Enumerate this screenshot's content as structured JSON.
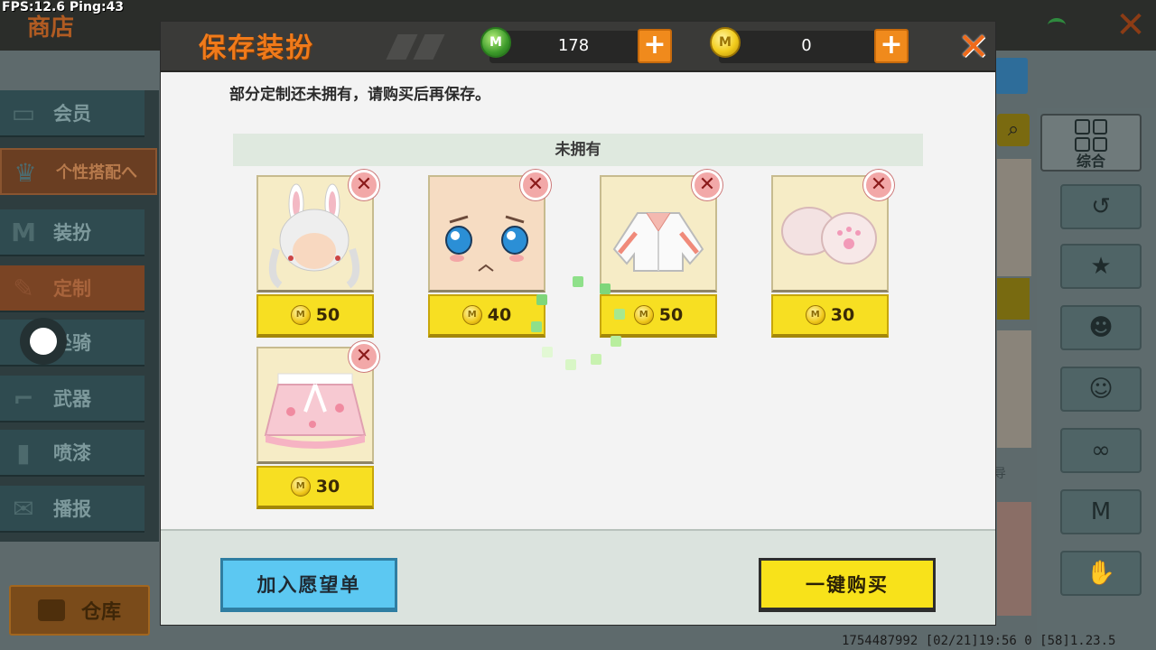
{
  "debug": {
    "fps_ping": "FPS:12.6  Ping:43"
  },
  "shop": {
    "title": "商店",
    "nav": [
      {
        "label": "会员",
        "icon": "vip-icon"
      },
      {
        "label": "个性搭配へ",
        "icon": "trophy-icon"
      },
      {
        "label": "装扮",
        "icon": "shirt-icon"
      },
      {
        "label": "定制",
        "icon": "brush-icon"
      },
      {
        "label": "坐骑",
        "icon": "mount-icon"
      },
      {
        "label": "武器",
        "icon": "gun-icon"
      },
      {
        "label": "喷漆",
        "icon": "spray-icon"
      },
      {
        "label": "播报",
        "icon": "broadcast-icon"
      }
    ],
    "warehouse_label": "仓库",
    "right_tab_label": "综合",
    "bottom_info": "1754487992  [02/21]19:56 0  [58]1.23.5",
    "ghost_char": "导"
  },
  "modal": {
    "title": "保存装扮",
    "gems": "178",
    "coins": "0",
    "notice": "部分定制还未拥有，请购买后再保存。",
    "section_label": "未拥有",
    "items": [
      {
        "name": "bunny-ear-hair",
        "price": "50"
      },
      {
        "name": "blushing-face",
        "price": "40"
      },
      {
        "name": "white-jacket",
        "price": "50"
      },
      {
        "name": "paw-gloves",
        "price": "30"
      },
      {
        "name": "pink-skirt",
        "price": "30"
      }
    ],
    "wishlist_label": "加入愿望单",
    "buy_all_label": "一键购买"
  },
  "colors": {
    "accent_orange": "#f07a1a",
    "price_yellow": "#f7df22",
    "wish_blue": "#5cc8f2",
    "header_dark": "#3a3a38"
  }
}
